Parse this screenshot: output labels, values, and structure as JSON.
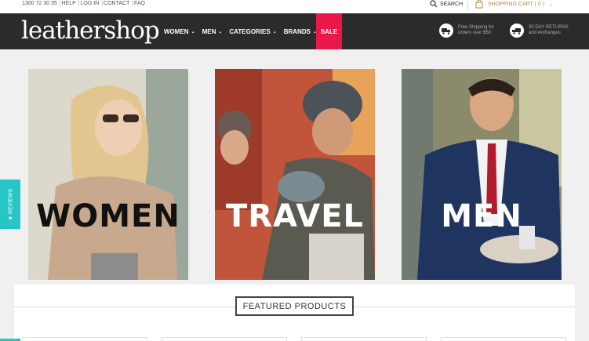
{
  "topbar": {
    "phone": "1300 72 30 35",
    "links": [
      "HELP",
      "LOG IN",
      "CONTACT",
      "FAQ"
    ],
    "search_label": "SEARCH",
    "cart_label": "SHOPPING CART ( 0 )"
  },
  "header": {
    "logo": "leathershop",
    "menu": [
      {
        "label": "WOMEN",
        "has_dropdown": true
      },
      {
        "label": "MEN",
        "has_dropdown": true
      },
      {
        "label": "CATEGORIES",
        "has_dropdown": true
      },
      {
        "label": "BRANDS",
        "has_dropdown": true
      }
    ],
    "sale_label": "SALE",
    "promos": [
      {
        "icon": "truck-icon",
        "line1": "Free Shipping for",
        "line2": "orders over $50"
      },
      {
        "icon": "return-truck-icon",
        "line1": "30 DAY RETURNS",
        "line2": "and exchanges"
      }
    ]
  },
  "banners": [
    {
      "label": "WOMEN",
      "text_color": "#111111"
    },
    {
      "label": "TRAVEL",
      "text_color": "#ffffff"
    },
    {
      "label": "MEN",
      "text_color": "#ffffff"
    }
  ],
  "reviews_tab": "★ REVIEWS",
  "featured_title": "FEATURED PRODUCTS",
  "colors": {
    "nav_bg": "#2b2b2b",
    "sale": "#e8194a",
    "accent_gold": "#b98a45",
    "reviews_teal": "#27c6c6"
  }
}
